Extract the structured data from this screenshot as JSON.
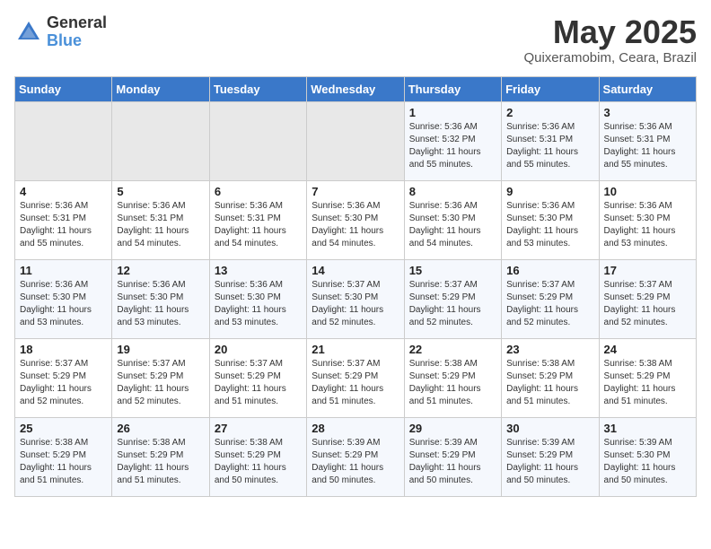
{
  "header": {
    "logo_general": "General",
    "logo_blue": "Blue",
    "month": "May 2025",
    "location": "Quixeramobim, Ceara, Brazil"
  },
  "days_of_week": [
    "Sunday",
    "Monday",
    "Tuesday",
    "Wednesday",
    "Thursday",
    "Friday",
    "Saturday"
  ],
  "weeks": [
    [
      {
        "day": "",
        "info": ""
      },
      {
        "day": "",
        "info": ""
      },
      {
        "day": "",
        "info": ""
      },
      {
        "day": "",
        "info": ""
      },
      {
        "day": "1",
        "info": "Sunrise: 5:36 AM\nSunset: 5:32 PM\nDaylight: 11 hours\nand 55 minutes."
      },
      {
        "day": "2",
        "info": "Sunrise: 5:36 AM\nSunset: 5:31 PM\nDaylight: 11 hours\nand 55 minutes."
      },
      {
        "day": "3",
        "info": "Sunrise: 5:36 AM\nSunset: 5:31 PM\nDaylight: 11 hours\nand 55 minutes."
      }
    ],
    [
      {
        "day": "4",
        "info": "Sunrise: 5:36 AM\nSunset: 5:31 PM\nDaylight: 11 hours\nand 55 minutes."
      },
      {
        "day": "5",
        "info": "Sunrise: 5:36 AM\nSunset: 5:31 PM\nDaylight: 11 hours\nand 54 minutes."
      },
      {
        "day": "6",
        "info": "Sunrise: 5:36 AM\nSunset: 5:31 PM\nDaylight: 11 hours\nand 54 minutes."
      },
      {
        "day": "7",
        "info": "Sunrise: 5:36 AM\nSunset: 5:30 PM\nDaylight: 11 hours\nand 54 minutes."
      },
      {
        "day": "8",
        "info": "Sunrise: 5:36 AM\nSunset: 5:30 PM\nDaylight: 11 hours\nand 54 minutes."
      },
      {
        "day": "9",
        "info": "Sunrise: 5:36 AM\nSunset: 5:30 PM\nDaylight: 11 hours\nand 53 minutes."
      },
      {
        "day": "10",
        "info": "Sunrise: 5:36 AM\nSunset: 5:30 PM\nDaylight: 11 hours\nand 53 minutes."
      }
    ],
    [
      {
        "day": "11",
        "info": "Sunrise: 5:36 AM\nSunset: 5:30 PM\nDaylight: 11 hours\nand 53 minutes."
      },
      {
        "day": "12",
        "info": "Sunrise: 5:36 AM\nSunset: 5:30 PM\nDaylight: 11 hours\nand 53 minutes."
      },
      {
        "day": "13",
        "info": "Sunrise: 5:36 AM\nSunset: 5:30 PM\nDaylight: 11 hours\nand 53 minutes."
      },
      {
        "day": "14",
        "info": "Sunrise: 5:37 AM\nSunset: 5:30 PM\nDaylight: 11 hours\nand 52 minutes."
      },
      {
        "day": "15",
        "info": "Sunrise: 5:37 AM\nSunset: 5:29 PM\nDaylight: 11 hours\nand 52 minutes."
      },
      {
        "day": "16",
        "info": "Sunrise: 5:37 AM\nSunset: 5:29 PM\nDaylight: 11 hours\nand 52 minutes."
      },
      {
        "day": "17",
        "info": "Sunrise: 5:37 AM\nSunset: 5:29 PM\nDaylight: 11 hours\nand 52 minutes."
      }
    ],
    [
      {
        "day": "18",
        "info": "Sunrise: 5:37 AM\nSunset: 5:29 PM\nDaylight: 11 hours\nand 52 minutes."
      },
      {
        "day": "19",
        "info": "Sunrise: 5:37 AM\nSunset: 5:29 PM\nDaylight: 11 hours\nand 52 minutes."
      },
      {
        "day": "20",
        "info": "Sunrise: 5:37 AM\nSunset: 5:29 PM\nDaylight: 11 hours\nand 51 minutes."
      },
      {
        "day": "21",
        "info": "Sunrise: 5:37 AM\nSunset: 5:29 PM\nDaylight: 11 hours\nand 51 minutes."
      },
      {
        "day": "22",
        "info": "Sunrise: 5:38 AM\nSunset: 5:29 PM\nDaylight: 11 hours\nand 51 minutes."
      },
      {
        "day": "23",
        "info": "Sunrise: 5:38 AM\nSunset: 5:29 PM\nDaylight: 11 hours\nand 51 minutes."
      },
      {
        "day": "24",
        "info": "Sunrise: 5:38 AM\nSunset: 5:29 PM\nDaylight: 11 hours\nand 51 minutes."
      }
    ],
    [
      {
        "day": "25",
        "info": "Sunrise: 5:38 AM\nSunset: 5:29 PM\nDaylight: 11 hours\nand 51 minutes."
      },
      {
        "day": "26",
        "info": "Sunrise: 5:38 AM\nSunset: 5:29 PM\nDaylight: 11 hours\nand 51 minutes."
      },
      {
        "day": "27",
        "info": "Sunrise: 5:38 AM\nSunset: 5:29 PM\nDaylight: 11 hours\nand 50 minutes."
      },
      {
        "day": "28",
        "info": "Sunrise: 5:39 AM\nSunset: 5:29 PM\nDaylight: 11 hours\nand 50 minutes."
      },
      {
        "day": "29",
        "info": "Sunrise: 5:39 AM\nSunset: 5:29 PM\nDaylight: 11 hours\nand 50 minutes."
      },
      {
        "day": "30",
        "info": "Sunrise: 5:39 AM\nSunset: 5:29 PM\nDaylight: 11 hours\nand 50 minutes."
      },
      {
        "day": "31",
        "info": "Sunrise: 5:39 AM\nSunset: 5:30 PM\nDaylight: 11 hours\nand 50 minutes."
      }
    ]
  ]
}
